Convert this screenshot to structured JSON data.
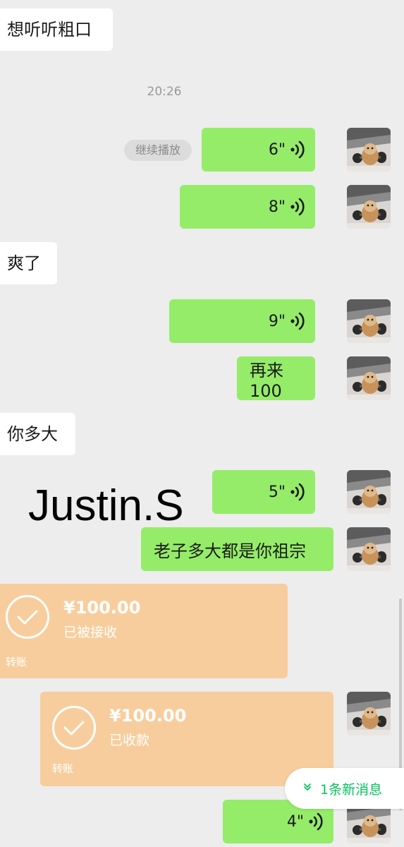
{
  "messages": {
    "m1": "想听听粗口",
    "m2": "爽了",
    "m3": "再来 100",
    "m4": "你多大",
    "m5": "老子多大都是你祖宗"
  },
  "timestamp": "20:26",
  "continue_play_label": "继续播放",
  "voices": {
    "v1": "6\"",
    "v2": "8\"",
    "v3": "9\"",
    "v4": "5\"",
    "v5": "4\""
  },
  "overlay_text": "Justin.S",
  "transfers": {
    "t1": {
      "amount": "¥100.00",
      "status": "已被接收",
      "label": "转账"
    },
    "t2": {
      "amount": "¥100.00",
      "status": "已收款",
      "label": "转账"
    }
  },
  "new_messages_label": "1条新消息",
  "colors": {
    "sent_bubble": "#95ec69",
    "received_bubble": "#ffffff",
    "transfer_card": "#f8cd9d",
    "accent": "#07c160",
    "background": "#ededed"
  },
  "icons": {
    "voice": "voice-wave-icon",
    "transfer": "check-circle-icon",
    "new_message": "double-chevron-down-icon"
  }
}
